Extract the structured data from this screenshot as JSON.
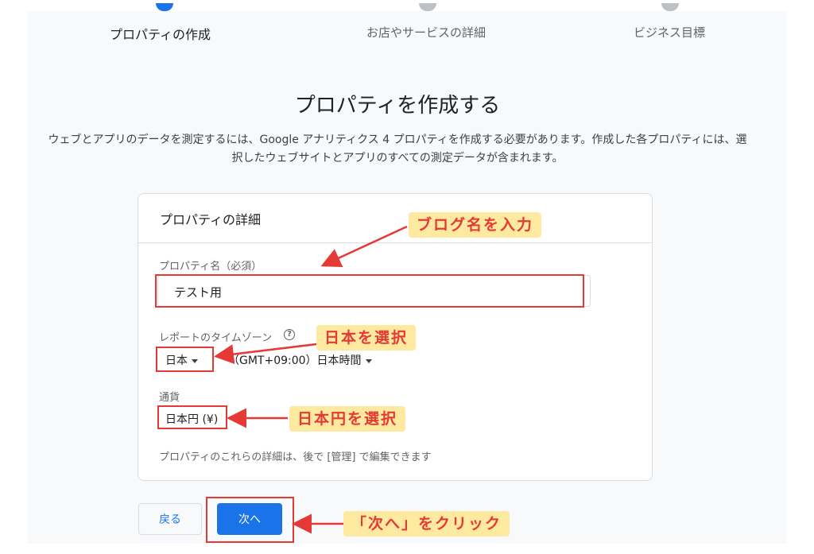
{
  "stepper": {
    "steps": [
      {
        "label": "プロパティの作成",
        "state": "active"
      },
      {
        "label": "お店やサービスの詳細",
        "state": "pending"
      },
      {
        "label": "ビジネス目標",
        "state": "pending"
      }
    ]
  },
  "heading": "プロパティを作成する",
  "description": "ウェブとアプリのデータを測定するには、Google アナリティクス 4 プロパティを作成する必要があります。作成した各プロパティには、選択したウェブサイトとアプリのすべての測定データが含まれます。",
  "card": {
    "title": "プロパティの詳細",
    "property_name": {
      "label": "プロパティ名（必須）",
      "value": "テスト用"
    },
    "timezone": {
      "label": "レポートのタイムゾーン",
      "help_icon": "help-circle-icon",
      "country": "日本",
      "zone": "（GMT+09:00）日本時間"
    },
    "currency": {
      "label": "通貨",
      "value": "日本円 (¥)"
    },
    "footnote": "プロパティのこれらの詳細は、後で [管理] で編集できます"
  },
  "buttons": {
    "back": "戻る",
    "next": "次へ"
  },
  "annotations": {
    "blog_name": "ブログ名を入力",
    "select_japan": "日本を選択",
    "select_yen": "日本円を選択",
    "click_next": "「次へ」をクリック"
  },
  "colors": {
    "accent_blue": "#1a73e8",
    "annotation_red": "#e53935",
    "callout_bg": "#fde9a0"
  }
}
